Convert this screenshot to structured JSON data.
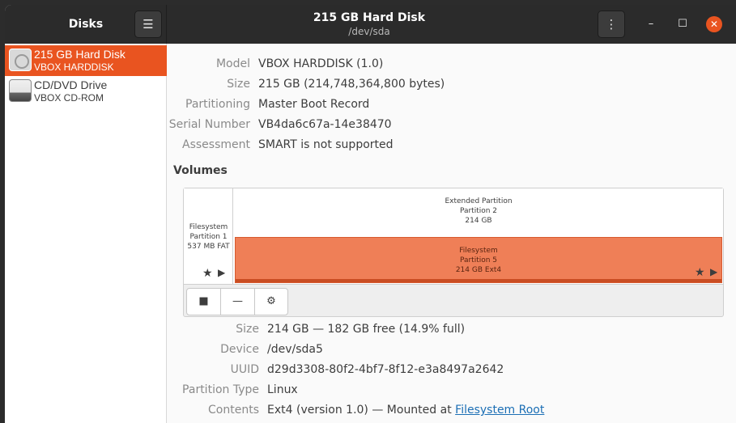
{
  "header": {
    "app_title": "Disks",
    "menu_icon": "hamburger-icon",
    "disk_title": "215 GB Hard Disk",
    "disk_subtitle": "/dev/sda",
    "disk_menu_icon": "vertical-dots-icon"
  },
  "window_controls": {
    "minimize_icon": "minimize-icon",
    "maximize_icon": "maximize-icon",
    "close_icon": "close-icon"
  },
  "sidebar": {
    "items": [
      {
        "name": "215 GB Hard Disk",
        "sub": "VBOX HARDDISK",
        "icon": "hard-disk-icon",
        "selected": true
      },
      {
        "name": "CD/DVD Drive",
        "sub": "VBOX CD-ROM",
        "icon": "optical-drive-icon",
        "selected": false
      }
    ]
  },
  "disk_info": {
    "model_label": "Model",
    "model_value": "VBOX HARDDISK (1.0)",
    "size_label": "Size",
    "size_value": "215 GB (214,748,364,800 bytes)",
    "partitioning_label": "Partitioning",
    "partitioning_value": "Master Boot Record",
    "serial_label": "Serial Number",
    "serial_value": "VB4da6c67a-14e38470",
    "assessment_label": "Assessment",
    "assessment_value": "SMART is not supported"
  },
  "volumes": {
    "title": "Volumes",
    "partition1": {
      "line1": "Filesystem",
      "line2": "Partition 1",
      "line3": "537 MB FAT"
    },
    "extended": {
      "line1": "Extended Partition",
      "line2": "Partition 2",
      "line3": "214 GB"
    },
    "partition5": {
      "line1": "Filesystem",
      "line2": "Partition 5",
      "line3": "214 GB Ext4"
    },
    "toolbar": {
      "stop_icon": "stop-icon",
      "remove_icon": "minus-icon",
      "settings_icon": "gears-icon"
    }
  },
  "partition_info": {
    "size_label": "Size",
    "size_value": "214 GB — 182 GB free (14.9% full)",
    "device_label": "Device",
    "device_value": "/dev/sda5",
    "uuid_label": "UUID",
    "uuid_value": "d29d3308-80f2-4bf7-8f12-e3a8497a2642",
    "type_label": "Partition Type",
    "type_value": "Linux",
    "contents_label": "Contents",
    "contents_value": "Ext4 (version 1.0) — Mounted at ",
    "contents_link": "Filesystem Root"
  },
  "colors": {
    "accent": "#e95420",
    "partition_fill": "#ef7f57",
    "headerbar": "#2b2b2b"
  }
}
